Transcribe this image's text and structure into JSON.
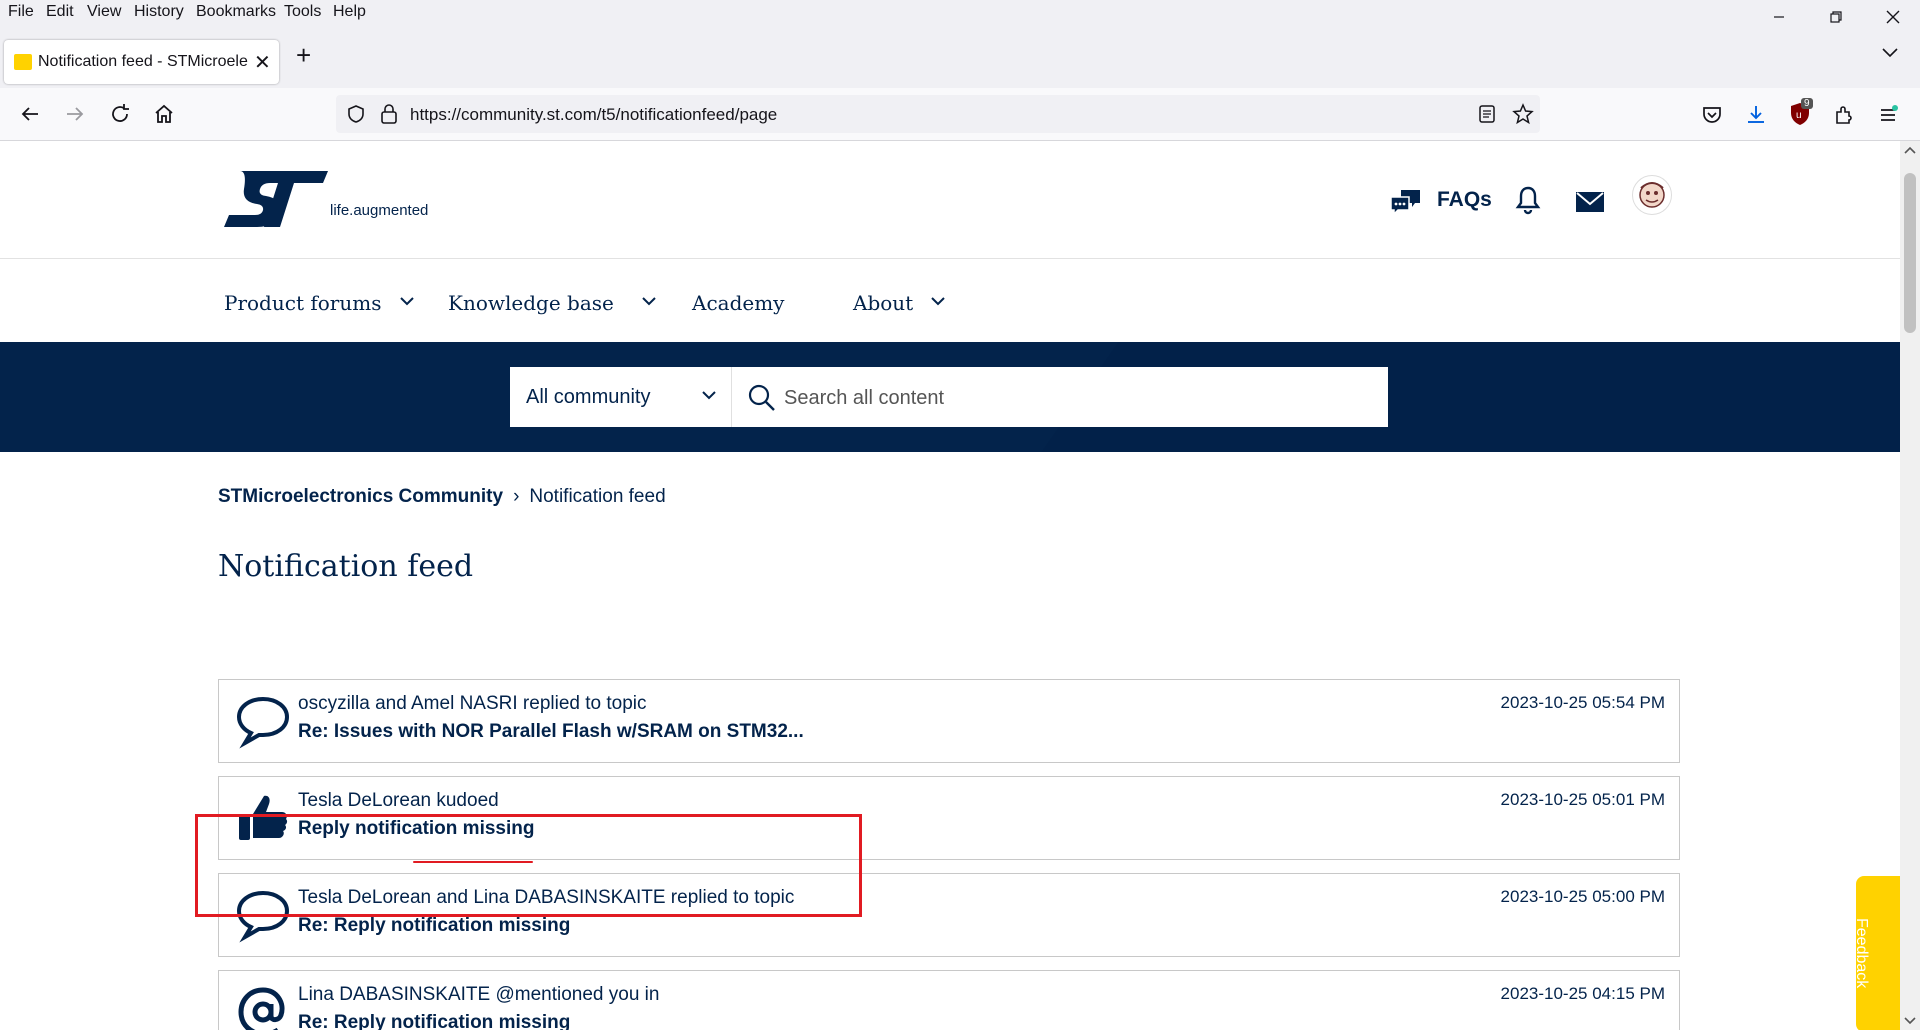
{
  "browser": {
    "menu": [
      "File",
      "Edit",
      "View",
      "History",
      "Bookmarks",
      "Tools",
      "Help"
    ],
    "tab_title": "Notification feed - STMicroelectronics Community",
    "url": "https://community.st.com/t5/notificationfeed/page",
    "extension_badge": "9"
  },
  "site": {
    "tagline": "life.augmented",
    "faqs": "FAQs",
    "nav": [
      "Product forums",
      "Knowledge base",
      "Academy",
      "About"
    ],
    "search_scope": "All community",
    "search_placeholder": "Search all content"
  },
  "breadcrumb": {
    "home": "STMicroelectronics Community",
    "separator": "›",
    "current": "Notification feed"
  },
  "page_title": "Notification feed",
  "feed": [
    {
      "icon": "speech-bubble-icon",
      "actor": "oscyzilla and Amel NASRI replied to topic",
      "subject": "Re: Issues with NOR Parallel Flash w/SRAM on STM32...",
      "time": "2023-10-25 05:54 PM"
    },
    {
      "icon": "thumbs-up-icon",
      "actor": "Tesla DeLorean kudoed",
      "subject": "Reply notification missing",
      "time": "2023-10-25 05:01 PM"
    },
    {
      "icon": "speech-bubble-icon",
      "actor": "Tesla DeLorean and Lina DABASINSKAITE replied to topic",
      "subject": "Re: Reply notification missing",
      "time": "2023-10-25 05:00 PM"
    },
    {
      "icon": "at-sign-icon",
      "actor": "Lina DABASINSKAITE @mentioned you in",
      "subject": "Re: Reply notification missing",
      "time": "2023-10-25 04:15 PM"
    }
  ],
  "feedback": "Feedback",
  "colors": {
    "brand_navy": "#03234b",
    "brand_yellow": "#ffd200",
    "annotation_red": "#e11b22"
  }
}
